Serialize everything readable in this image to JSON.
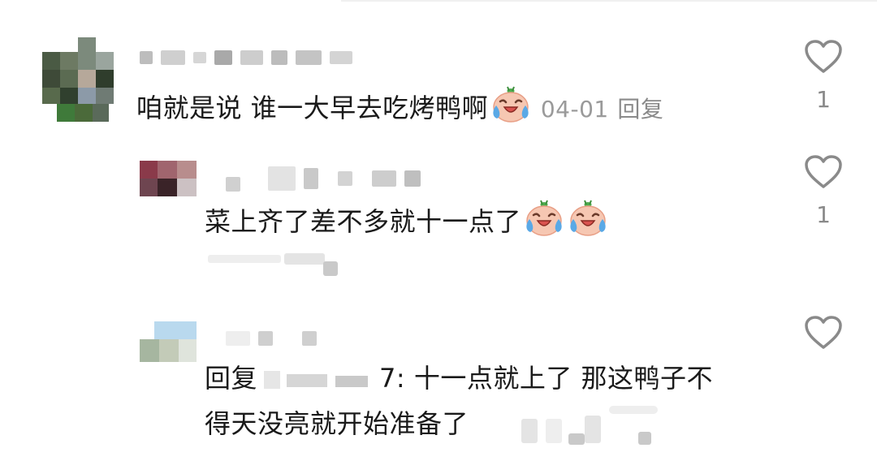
{
  "comments": [
    {
      "text": "咱就是说 谁一大早去吃烤鸭啊",
      "date": "04-01",
      "reply_label": "回复",
      "likes": "1",
      "emoji": "crying-laughing-face"
    },
    {
      "text": "菜上齐了差不多就十一点了",
      "likes": "1",
      "emoji": "crying-laughing-face"
    },
    {
      "prefix": "回复",
      "text_line1": "7: 十一点就上了 那这鸭子不",
      "text_line2": "得天没亮就开始准备了",
      "likes": ""
    }
  ],
  "colors": {
    "text": "#1a1a1a",
    "meta": "#9a9a9a",
    "icon": "#8a8a8a"
  }
}
